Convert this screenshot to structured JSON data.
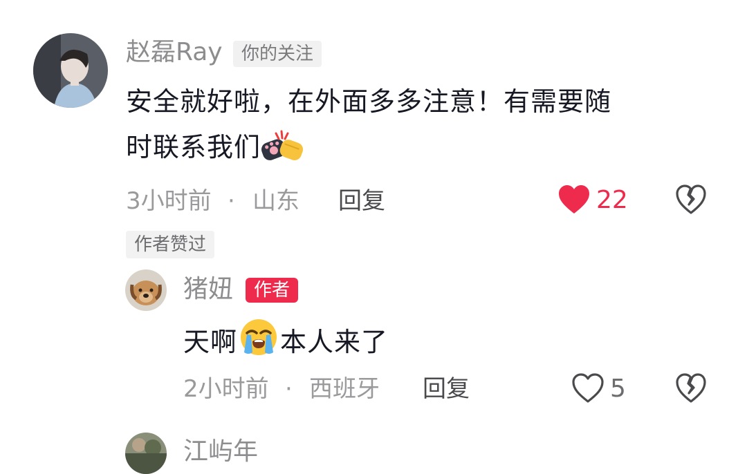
{
  "comments": [
    {
      "user": "赵磊Ray",
      "badge": "你的关注",
      "text_lines": [
        "安全就好啦，在外面多多注意！有需要随",
        "时联系我们"
      ],
      "emoji": "fist-bump-emoji",
      "time": "3小时前",
      "location": "山东",
      "reply_label": "回复",
      "likes": "22",
      "liked": true,
      "author_liked_label": "作者赞过",
      "colors": {
        "like": "#ee2b4d"
      }
    }
  ],
  "replies": [
    {
      "user": "猪妞",
      "badge": "作者",
      "text_before": "天啊",
      "emoji": "loudly-crying-emoji",
      "text_after": "本人来了",
      "time": "2小时前",
      "location": "西班牙",
      "reply_label": "回复",
      "likes": "5",
      "liked": false
    }
  ],
  "next_comment": {
    "user": "江屿年"
  },
  "separator": "·",
  "colors": {
    "author_badge": "#ee2b4d",
    "text": "#161823",
    "muted": "#9a9a9c"
  }
}
